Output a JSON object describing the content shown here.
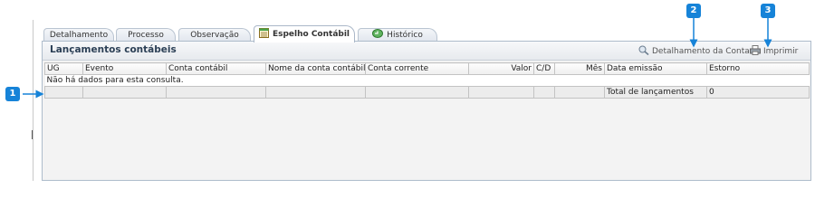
{
  "tabs": [
    {
      "label": "Detalhamento",
      "active": false
    },
    {
      "label": "Processo",
      "active": false
    },
    {
      "label": "Observação",
      "active": false
    },
    {
      "label": "Espelho Contábil",
      "active": true,
      "icon": "ledger-icon"
    },
    {
      "label": "Histórico",
      "active": false,
      "icon": "history-icon"
    }
  ],
  "panel": {
    "title": "Lançamentos contábeis",
    "detail_button": "Detalhamento da Conta",
    "print_button": "Imprimir"
  },
  "grid": {
    "columns": [
      "UG",
      "Evento",
      "Conta contábil",
      "Nome da conta contábil",
      "Conta corrente",
      "Valor",
      "C/D",
      "Mês",
      "Data emissão",
      "Estorno"
    ],
    "empty_message": "Não há dados para esta consulta.",
    "total_label": "Total de lançamentos",
    "total_value": "0"
  },
  "callouts": [
    "1",
    "2",
    "3"
  ],
  "colors": {
    "callout": "#1683d8",
    "title": "#2b3f55",
    "panel_border": "#aebccb"
  }
}
